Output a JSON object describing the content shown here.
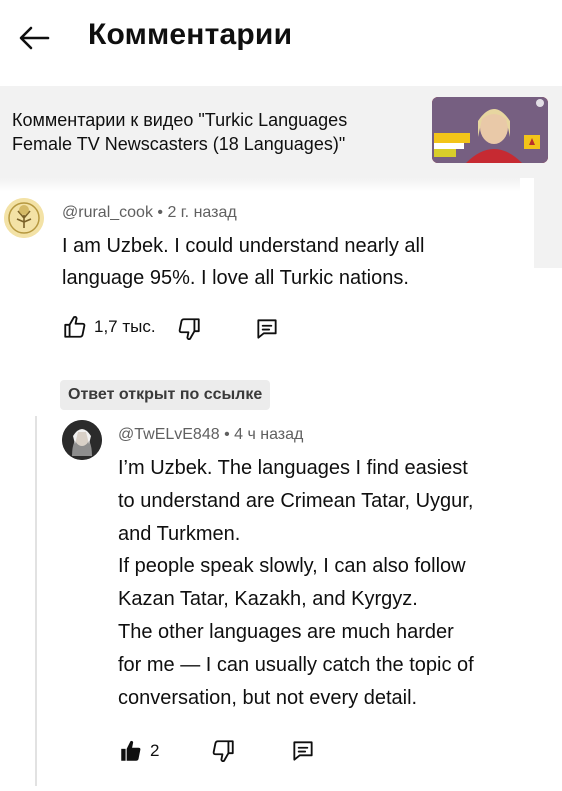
{
  "header": {
    "title": "Комментарии"
  },
  "video": {
    "caption": "Комментарии к видео \"Turkic Languages Female TV Newscasters (18 Languages)\""
  },
  "comment": {
    "author": "@rural_cook",
    "time": "2 г. назад",
    "text": "I am Uzbek. I could understand nearly all language 95%. I love all Turkic nations.",
    "likes": "1,7 тыс."
  },
  "reply_badge": "Ответ открыт по ссылке",
  "reply": {
    "author": "@TwELvE848",
    "time": "4 ч назад",
    "lines": [
      "I’m Uzbek. The languages I find easiest",
      "to understand are Crimean Tatar, Uygur,",
      "and Turkmen.",
      "If people speak slowly, I can also follow",
      "Kazan Tatar, Kazakh, and Kyrgyz.",
      "The other languages are much harder",
      "for me — I can usually catch the topic of",
      "conversation, but not every detail."
    ],
    "likes": "2"
  },
  "icons": {
    "back": "arrow-left-icon",
    "like": "thumb-up-icon",
    "dislike": "thumb-down-icon",
    "reply": "comment-icon"
  },
  "colors": {
    "text": "#0f0f0f",
    "meta": "#606060",
    "card": "#f2f2f2"
  }
}
